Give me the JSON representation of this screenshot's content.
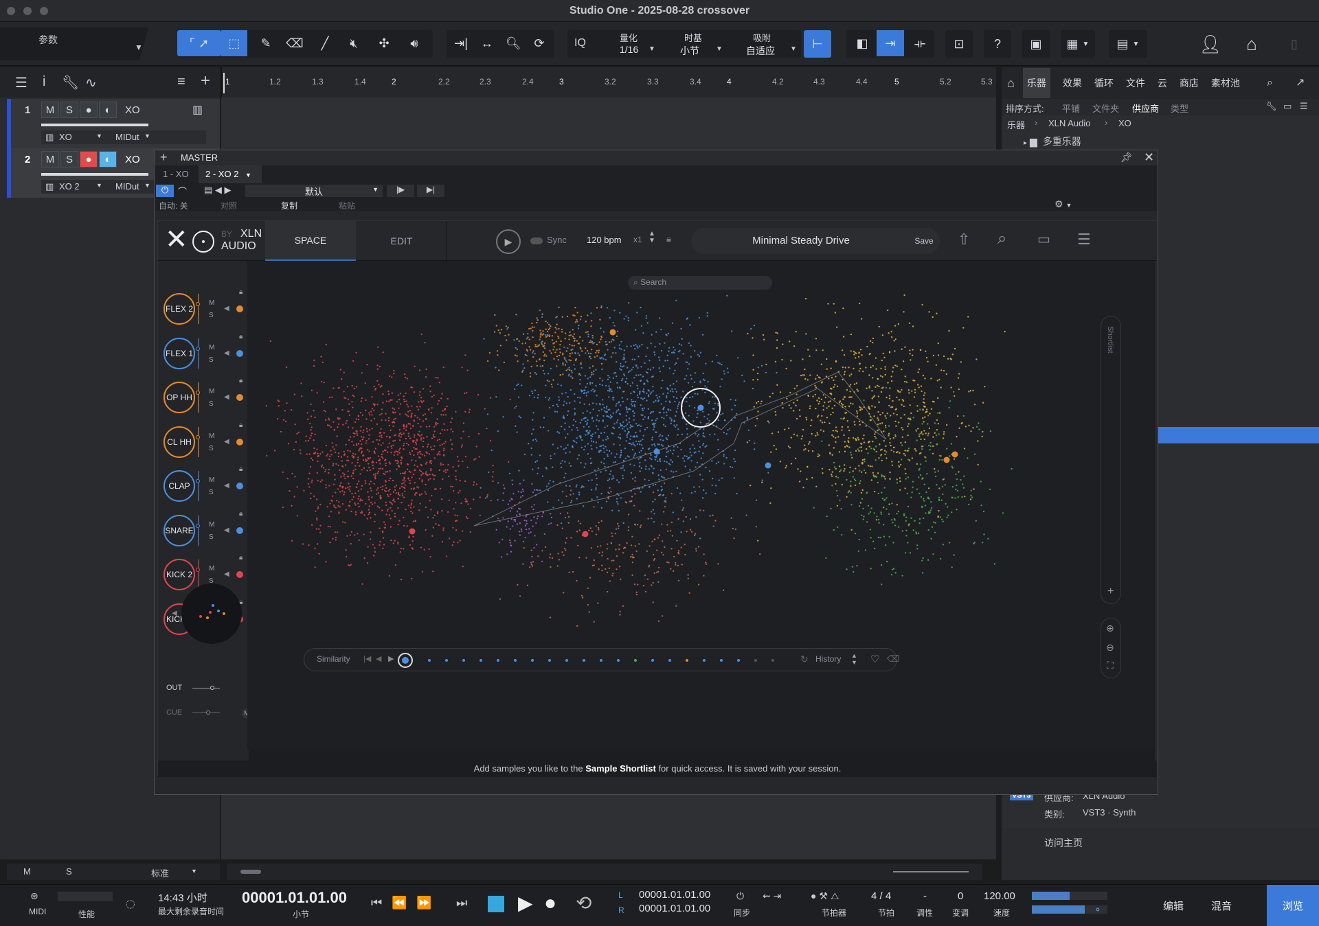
{
  "window": {
    "title": "Studio One - 2025-08-28 crossover"
  },
  "toolbar": {
    "param_label": "参数",
    "quantize_label": "量化",
    "quantize_value": "1/16",
    "timebase_label": "时基",
    "timebase_value": "小节",
    "snap_label": "吸附",
    "snap_value": "自适应",
    "iq": "IQ"
  },
  "ruler": {
    "marks": [
      "1",
      "1.2",
      "1.3",
      "1.4",
      "2",
      "2.2",
      "2.3",
      "2.4",
      "3",
      "3.2",
      "3.3",
      "3.4",
      "4",
      "4.2",
      "4.3",
      "4.4",
      "5",
      "5.2",
      "5.3"
    ]
  },
  "tracks": [
    {
      "num": "1",
      "name": "XO",
      "input": "XO",
      "output": "MIDut"
    },
    {
      "num": "2",
      "name": "XO",
      "input": "XO 2",
      "output": "MIDut"
    }
  ],
  "track_buttons": {
    "mute": "M",
    "solo": "S"
  },
  "browser": {
    "tabs": [
      "乐器",
      "效果",
      "循环",
      "文件",
      "云",
      "商店",
      "素材池"
    ],
    "sort_label": "排序方式:",
    "sort_options": [
      "平铺",
      "文件夹",
      "供应商",
      "类型"
    ],
    "path": [
      "乐器",
      "XLN Audio",
      "XO"
    ],
    "folder": "多重乐器",
    "info_vendor_label": "供应商:",
    "info_vendor": "XLN Audio",
    "info_category_label": "类别:",
    "info_category": "VST3 · Synth",
    "info_badge": "VST3",
    "visit_home": "访问主页"
  },
  "plugin_window": {
    "title": "MASTER",
    "tabs": [
      "1 - XO",
      "2 - XO 2"
    ],
    "preset": "默认",
    "auto_label": "自动: 关",
    "compare": "对照",
    "copy": "复制",
    "paste": "粘贴"
  },
  "xo": {
    "logo": "XO",
    "by": "BY",
    "xln": "XLN",
    "audio": "AUDIO",
    "tabs": [
      "SPACE",
      "EDIT"
    ],
    "sync": "Sync",
    "bpm": "120 bpm",
    "mult": "x1",
    "preset": "Minimal Steady Drive",
    "save": "Save",
    "search_placeholder": "Search",
    "shortlist": "Shortlist",
    "pads": [
      {
        "label": "FLEX 2",
        "color": "#e58a2e"
      },
      {
        "label": "FLEX 1",
        "color": "#4a90e2"
      },
      {
        "label": "OP HH",
        "color": "#e58a2e"
      },
      {
        "label": "CL HH",
        "color": "#e58a2e"
      },
      {
        "label": "CLAP",
        "color": "#4a90e2"
      },
      {
        "label": "SNARE",
        "color": "#4a90e2"
      },
      {
        "label": "KICK 2",
        "color": "#e0454f"
      },
      {
        "label": "KICK 1",
        "color": "#e0454f"
      }
    ],
    "pad_m": "M",
    "pad_s": "S",
    "out": "OUT",
    "cue": "CUE",
    "cue_m": "M",
    "similarity": "Similarity",
    "history": "History",
    "status_pre": "Add samples you like to the ",
    "status_bold": "Sample Shortlist",
    "status_post": " for quick access. It is saved with your session."
  },
  "transport": {
    "midi": "MIDI",
    "perf": "性能",
    "time": "14:43 小时",
    "time_sub": "最大剩余录音时间",
    "position": "00001.01.01.00",
    "pos_unit": "小节",
    "loop_l": "00001.01.01.00",
    "loop_r": "00001.01.01.00",
    "lr_l": "L",
    "lr_r": "R",
    "sync": "同步",
    "metronome": "节拍器",
    "sig": "4 / 4",
    "sig_label": "节拍",
    "key": "-",
    "key_label": "调性",
    "transpose": "0",
    "transpose_label": "变调",
    "tempo": "120.00",
    "tempo_label": "速度",
    "edit": "编辑",
    "mix": "混音",
    "browse": "浏览"
  },
  "track_footer": {
    "m": "M",
    "s": "S",
    "std": "标准"
  }
}
